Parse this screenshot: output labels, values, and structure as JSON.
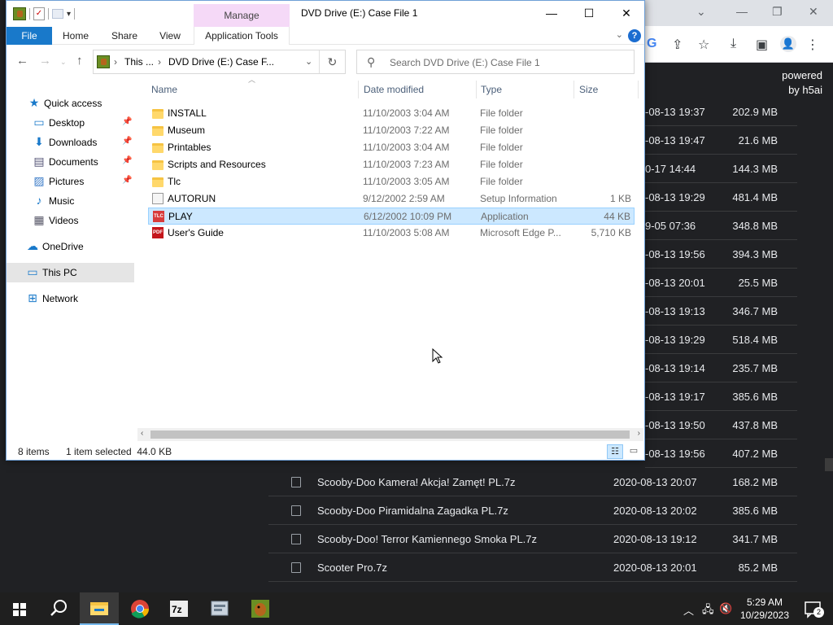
{
  "explorer": {
    "window_title": "DVD Drive (E:) Case File 1",
    "manage_tab": "Manage",
    "ribbon_tabs": [
      "File",
      "Home",
      "Share",
      "View",
      "Application Tools"
    ],
    "address": {
      "crumb1": "This ...",
      "crumb2": "DVD Drive (E:) Case F..."
    },
    "search_placeholder": "Search DVD Drive (E:) Case File 1",
    "nav": [
      {
        "label": "Quick access",
        "icon": "star-icon"
      },
      {
        "label": "Desktop",
        "icon": "desktop-icon",
        "pinned": true
      },
      {
        "label": "Downloads",
        "icon": "download-arrow-icon",
        "pinned": true
      },
      {
        "label": "Documents",
        "icon": "document-icon",
        "pinned": true
      },
      {
        "label": "Pictures",
        "icon": "picture-icon",
        "pinned": true
      },
      {
        "label": "Music",
        "icon": "music-note-icon"
      },
      {
        "label": "Videos",
        "icon": "film-icon"
      },
      {
        "label": "OneDrive",
        "icon": "cloud-icon"
      },
      {
        "label": "This PC",
        "icon": "monitor-icon",
        "selected": true
      },
      {
        "label": "Network",
        "icon": "network-icon"
      }
    ],
    "columns": {
      "name": "Name",
      "date": "Date modified",
      "type": "Type",
      "size": "Size"
    },
    "files": [
      {
        "name": "INSTALL",
        "date": "11/10/2003 3:04 AM",
        "type": "File folder",
        "size": "",
        "icon": "folder-icon"
      },
      {
        "name": "Museum",
        "date": "11/10/2003 7:22 AM",
        "type": "File folder",
        "size": "",
        "icon": "folder-icon"
      },
      {
        "name": "Printables",
        "date": "11/10/2003 3:04 AM",
        "type": "File folder",
        "size": "",
        "icon": "folder-icon"
      },
      {
        "name": "Scripts and Resources",
        "date": "11/10/2003 7:23 AM",
        "type": "File folder",
        "size": "",
        "icon": "folder-icon"
      },
      {
        "name": "Tlc",
        "date": "11/10/2003 3:05 AM",
        "type": "File folder",
        "size": "",
        "icon": "folder-icon"
      },
      {
        "name": "AUTORUN",
        "date": "9/12/2002 2:59 AM",
        "type": "Setup Information",
        "size": "1 KB",
        "icon": "setup-info-icon"
      },
      {
        "name": "PLAY",
        "date": "6/12/2002 10:09 PM",
        "type": "Application",
        "size": "44 KB",
        "icon": "application-icon",
        "selected": true
      },
      {
        "name": "User's Guide",
        "date": "11/10/2003 5:08 AM",
        "type": "Microsoft Edge P...",
        "size": "5,710 KB",
        "icon": "pdf-icon"
      }
    ],
    "status": {
      "count": "8 items",
      "selection": "1 item selected  44.0 KB"
    }
  },
  "browser": {
    "powered": "powered",
    "by": "by h5ai",
    "behind_rows": [
      {
        "date": "-08-13 19:37",
        "size": "202.9 MB"
      },
      {
        "date": "-08-13 19:47",
        "size": "21.6 MB"
      },
      {
        "date": "0-17 14:44",
        "size": "144.3 MB"
      },
      {
        "date": "-08-13 19:29",
        "size": "481.4 MB"
      },
      {
        "date": "9-05 07:36",
        "size": "348.8 MB"
      },
      {
        "date": "-08-13 19:56",
        "size": "394.3 MB"
      },
      {
        "date": "-08-13 20:01",
        "size": "25.5 MB"
      },
      {
        "date": "-08-13 19:13",
        "size": "346.7 MB"
      },
      {
        "date": "-08-13 19:29",
        "size": "518.4 MB"
      },
      {
        "date": "-08-13 19:14",
        "size": "235.7 MB"
      },
      {
        "date": "-08-13 19:17",
        "size": "385.6 MB"
      },
      {
        "date": "-08-13 19:50",
        "size": "437.8 MB"
      },
      {
        "date": "-08-13 19:56",
        "size": "407.2 MB"
      }
    ],
    "rows": [
      {
        "name": "Scooby-Doo Kamera! Akcja! Zamęt! PL.7z",
        "date": "2020-08-13 20:07",
        "size": "168.2 MB"
      },
      {
        "name": "Scooby-Doo Piramidalna Zagadka PL.7z",
        "date": "2020-08-13 20:02",
        "size": "385.6 MB"
      },
      {
        "name": "Scooby-Doo! Terror Kamiennego Smoka PL.7z",
        "date": "2020-08-13 19:12",
        "size": "341.7 MB"
      },
      {
        "name": "Scooter Pro.7z",
        "date": "2020-08-13 20:01",
        "size": "85.2 MB"
      }
    ]
  },
  "taskbar": {
    "time": "5:29 AM",
    "date": "10/29/2023",
    "notification_count": "2",
    "apps": [
      "start-icon",
      "search-icon",
      "file-explorer-icon",
      "chrome-icon",
      "7zip-icon",
      "app-icon",
      "scooby-game-icon"
    ]
  }
}
